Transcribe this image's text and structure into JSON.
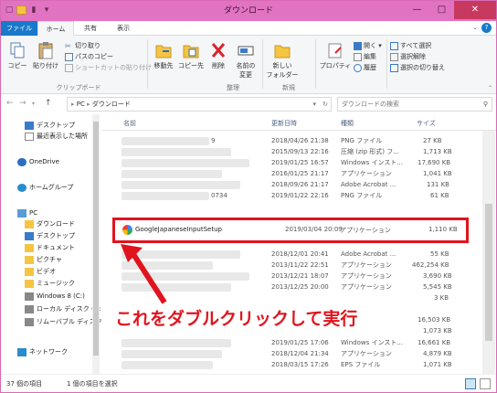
{
  "window": {
    "title": "ダウンロード"
  },
  "ribbon_tabs": [
    "ファイル",
    "ホーム",
    "共有",
    "表示"
  ],
  "ribbon": {
    "copy": "コピー",
    "paste": "貼り付け",
    "cut": "切り取り",
    "copy_path": "パスのコピー",
    "paste_shortcut": "ショートカットの貼り付け",
    "group_clipboard": "クリップボード",
    "move_to": "移動先",
    "copy_to": "コピー先",
    "delete": "削除",
    "rename_1": "名前の",
    "rename_2": "変更",
    "group_organize": "整理",
    "new_folder_1": "新しい",
    "new_folder_2": "フォルダー",
    "group_new": "新規",
    "properties": "プロパティ",
    "open": "開く",
    "edit": "編集",
    "history": "履歴",
    "select_all": "すべて選択",
    "select_none": "選択解除",
    "invert_selection": "選択の切り替え"
  },
  "address": {
    "path_root": "PC",
    "path_folder": "ダウンロード",
    "search_placeholder": "ダウンロードの検索"
  },
  "sidebar": {
    "items": [
      "デスクトップ",
      "最近表示した場所",
      "OneDrive",
      "ホームグループ",
      "PC",
      "ダウンロード",
      "デスクトップ",
      "ドキュメント",
      "ピクチャ",
      "ビデオ",
      "ミュージック",
      "Windows 8 (C:)",
      "ローカル ディスク (D:",
      "リムーバブル ディスク",
      "ネットワーク"
    ]
  },
  "columns": {
    "name": "名前",
    "date": "更新日時",
    "type": "種類",
    "size": "サイズ"
  },
  "rows": [
    {
      "name_suffix": "9",
      "date": "2018/04/26 21:38",
      "type": "PNG ファイル",
      "size": "27 KB"
    },
    {
      "name_suffix": "",
      "date": "2015/09/13 22:16",
      "type": "圧縮 (zip 形式) フ...",
      "size": "1,713 KB"
    },
    {
      "name_suffix": "",
      "date": "2019/01/25 16:57",
      "type": "Windows インスト...",
      "size": "17,690 KB"
    },
    {
      "name_suffix": "",
      "date": "2016/01/25 21:17",
      "type": "アプリケーション",
      "size": "1,041 KB"
    },
    {
      "name_suffix": "",
      "date": "2018/09/26 21:17",
      "type": "Adobe Acrobat ...",
      "size": "131 KB"
    },
    {
      "name_suffix": "0734",
      "date": "2019/01/22 22:16",
      "type": "PNG ファイル",
      "size": "61 KB"
    }
  ],
  "highlight_row": {
    "name": "GoogleJapaneseInputSetup",
    "date": "2019/03/04 20:09",
    "type": "アプリケーション",
    "size": "1,110 KB"
  },
  "rows_after": [
    {
      "date": "2018/12/01 20:41",
      "type": "Adobe Acrobat ...",
      "size": "55 KB"
    },
    {
      "date": "2013/11/22 22:51",
      "type": "アプリケーション",
      "size": "462,254 KB"
    },
    {
      "date": "2013/12/21 18:07",
      "type": "アプリケーション",
      "size": "3,690 KB"
    },
    {
      "date": "2013/12/25 20:00",
      "type": "アプリケーション",
      "size": "5,545 KB"
    },
    {
      "date": "",
      "type": "",
      "size": "3 KB"
    },
    {
      "date": "",
      "type": "",
      "size": "16,503 KB"
    },
    {
      "date": "",
      "type": "",
      "size": "1,073 KB"
    },
    {
      "date": "2019/01/25 17:06",
      "type": "Windows インスト...",
      "size": "16,661 KB"
    },
    {
      "date": "2018/12/04 21:34",
      "type": "アプリケーション",
      "size": "4,879 KB"
    },
    {
      "date": "2018/03/15 17:26",
      "type": "EPS ファイル",
      "size": "1,071 KB"
    }
  ],
  "callout": "これをダブルクリックして実行",
  "status": {
    "count": "37 個の項目",
    "selected": "1 個の項目を選択"
  },
  "colors": {
    "titlebar": "#e173c2",
    "accent": "#1979ca",
    "highlight": "#e0141e"
  }
}
